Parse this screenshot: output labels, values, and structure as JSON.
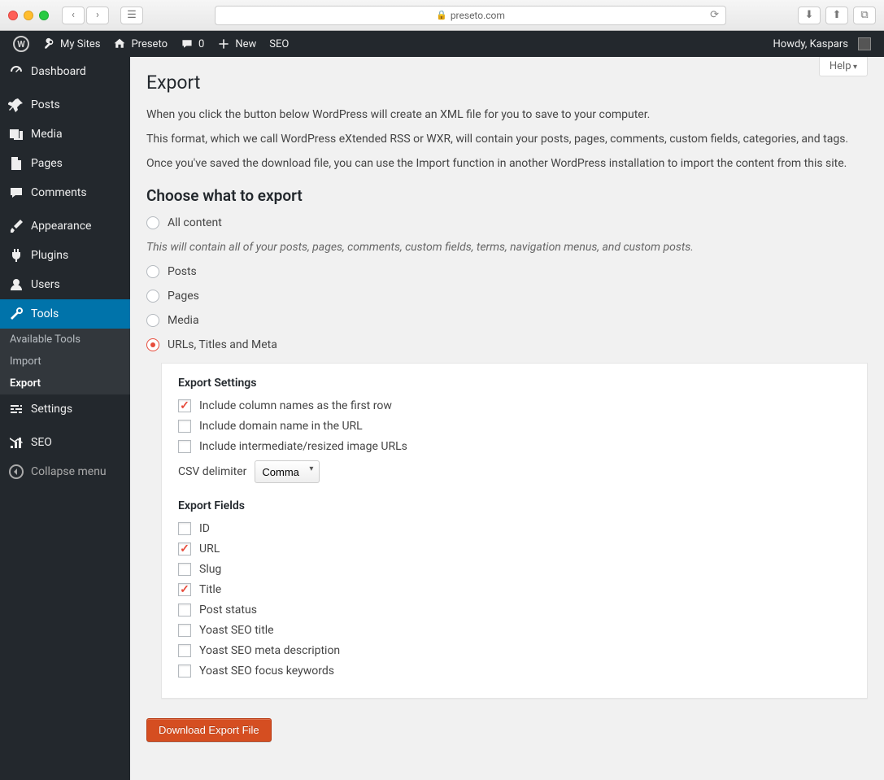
{
  "browser": {
    "url_host": "preseto.com"
  },
  "adminbar": {
    "my_sites": "My Sites",
    "site_name": "Preseto",
    "comment_count": "0",
    "new_label": "New",
    "seo_label": "SEO",
    "howdy": "Howdy, Kaspars"
  },
  "sidebar": {
    "items": [
      {
        "label": "Dashboard",
        "icon": "dashboard"
      },
      {
        "label": "Posts",
        "icon": "pin"
      },
      {
        "label": "Media",
        "icon": "media"
      },
      {
        "label": "Pages",
        "icon": "page"
      },
      {
        "label": "Comments",
        "icon": "comment"
      },
      {
        "label": "Appearance",
        "icon": "brush"
      },
      {
        "label": "Plugins",
        "icon": "plug"
      },
      {
        "label": "Users",
        "icon": "user"
      },
      {
        "label": "Tools",
        "icon": "wrench"
      },
      {
        "label": "Settings",
        "icon": "settings"
      },
      {
        "label": "SEO",
        "icon": "seo"
      },
      {
        "label": "Collapse menu",
        "icon": "collapse"
      }
    ],
    "tools_submenu": [
      "Available Tools",
      "Import",
      "Export"
    ]
  },
  "page": {
    "help": "Help",
    "title": "Export",
    "desc1": "When you click the button below WordPress will create an XML file for you to save to your computer.",
    "desc2": "This format, which we call WordPress eXtended RSS or WXR, will contain your posts, pages, comments, custom fields, categories, and tags.",
    "desc3": "Once you've saved the download file, you can use the Import function in another WordPress installation to import the content from this site.",
    "choose_heading": "Choose what to export",
    "hint": "This will contain all of your posts, pages, comments, custom fields, terms, navigation menus, and custom posts.",
    "radios": [
      "All content",
      "Posts",
      "Pages",
      "Media",
      "URLs, Titles and Meta"
    ],
    "settings_heading": "Export Settings",
    "setting_checks": [
      {
        "label": "Include column names as the first row",
        "checked": true
      },
      {
        "label": "Include domain name in the URL",
        "checked": false
      },
      {
        "label": "Include intermediate/resized image URLs",
        "checked": false
      }
    ],
    "delimiter_label": "CSV delimiter",
    "delimiter_value": "Comma",
    "fields_heading": "Export Fields",
    "field_checks": [
      {
        "label": "ID",
        "checked": false
      },
      {
        "label": "URL",
        "checked": true
      },
      {
        "label": "Slug",
        "checked": false
      },
      {
        "label": "Title",
        "checked": true
      },
      {
        "label": "Post status",
        "checked": false
      },
      {
        "label": "Yoast SEO title",
        "checked": false
      },
      {
        "label": "Yoast SEO meta description",
        "checked": false
      },
      {
        "label": "Yoast SEO focus keywords",
        "checked": false
      }
    ],
    "download_button": "Download Export File"
  }
}
